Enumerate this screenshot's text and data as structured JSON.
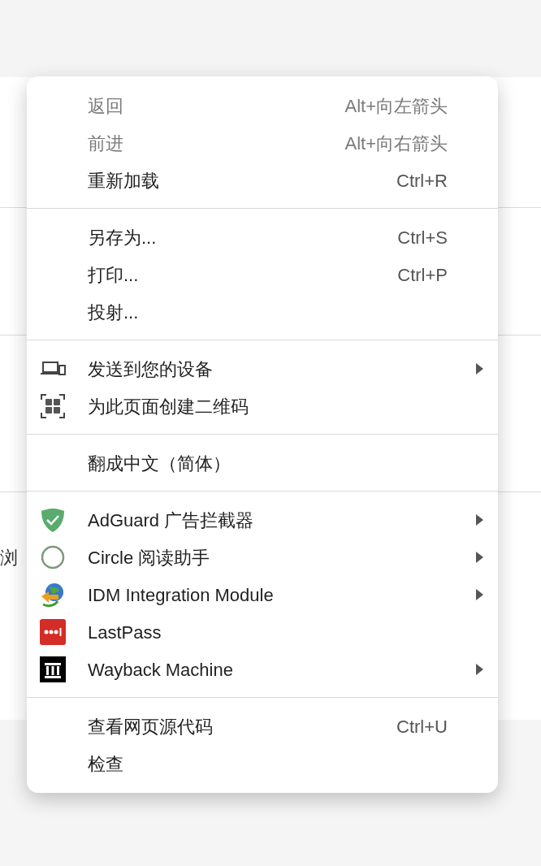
{
  "page": {
    "partial_text": "浏"
  },
  "menu": {
    "sections": [
      {
        "items": [
          {
            "label": "返回",
            "shortcut": "Alt+向左箭头",
            "disabled": true,
            "submenu": false
          },
          {
            "label": "前进",
            "shortcut": "Alt+向右箭头",
            "disabled": true,
            "submenu": false
          },
          {
            "label": "重新加载",
            "shortcut": "Ctrl+R",
            "disabled": false,
            "submenu": false
          }
        ]
      },
      {
        "items": [
          {
            "label": "另存为...",
            "shortcut": "Ctrl+S",
            "disabled": false,
            "submenu": false
          },
          {
            "label": "打印...",
            "shortcut": "Ctrl+P",
            "disabled": false,
            "submenu": false
          },
          {
            "label": "投射...",
            "disabled": false,
            "submenu": false
          }
        ]
      },
      {
        "items": [
          {
            "label": "发送到您的设备",
            "kind": "devices",
            "disabled": false,
            "submenu": true
          },
          {
            "label": "为此页面创建二维码",
            "kind": "qr",
            "disabled": false,
            "submenu": false
          }
        ]
      },
      {
        "items": [
          {
            "label": "翻成中文（简体）",
            "disabled": false,
            "submenu": false
          }
        ]
      },
      {
        "items": [
          {
            "label": "AdGuard 广告拦截器",
            "kind": "shield",
            "disabled": false,
            "submenu": true
          },
          {
            "label": "Circle 阅读助手",
            "kind": "circle",
            "disabled": false,
            "submenu": true
          },
          {
            "label": "IDM Integration Module",
            "kind": "globe",
            "disabled": false,
            "submenu": true
          },
          {
            "label": "LastPass",
            "kind": "dots",
            "disabled": false,
            "submenu": false
          },
          {
            "label": "Wayback Machine",
            "kind": "pillars",
            "disabled": false,
            "submenu": true
          }
        ]
      },
      {
        "items": [
          {
            "label": "查看网页源代码",
            "shortcut": "Ctrl+U",
            "disabled": false,
            "submenu": false
          },
          {
            "label": "检查",
            "disabled": false,
            "submenu": false
          }
        ]
      }
    ]
  }
}
